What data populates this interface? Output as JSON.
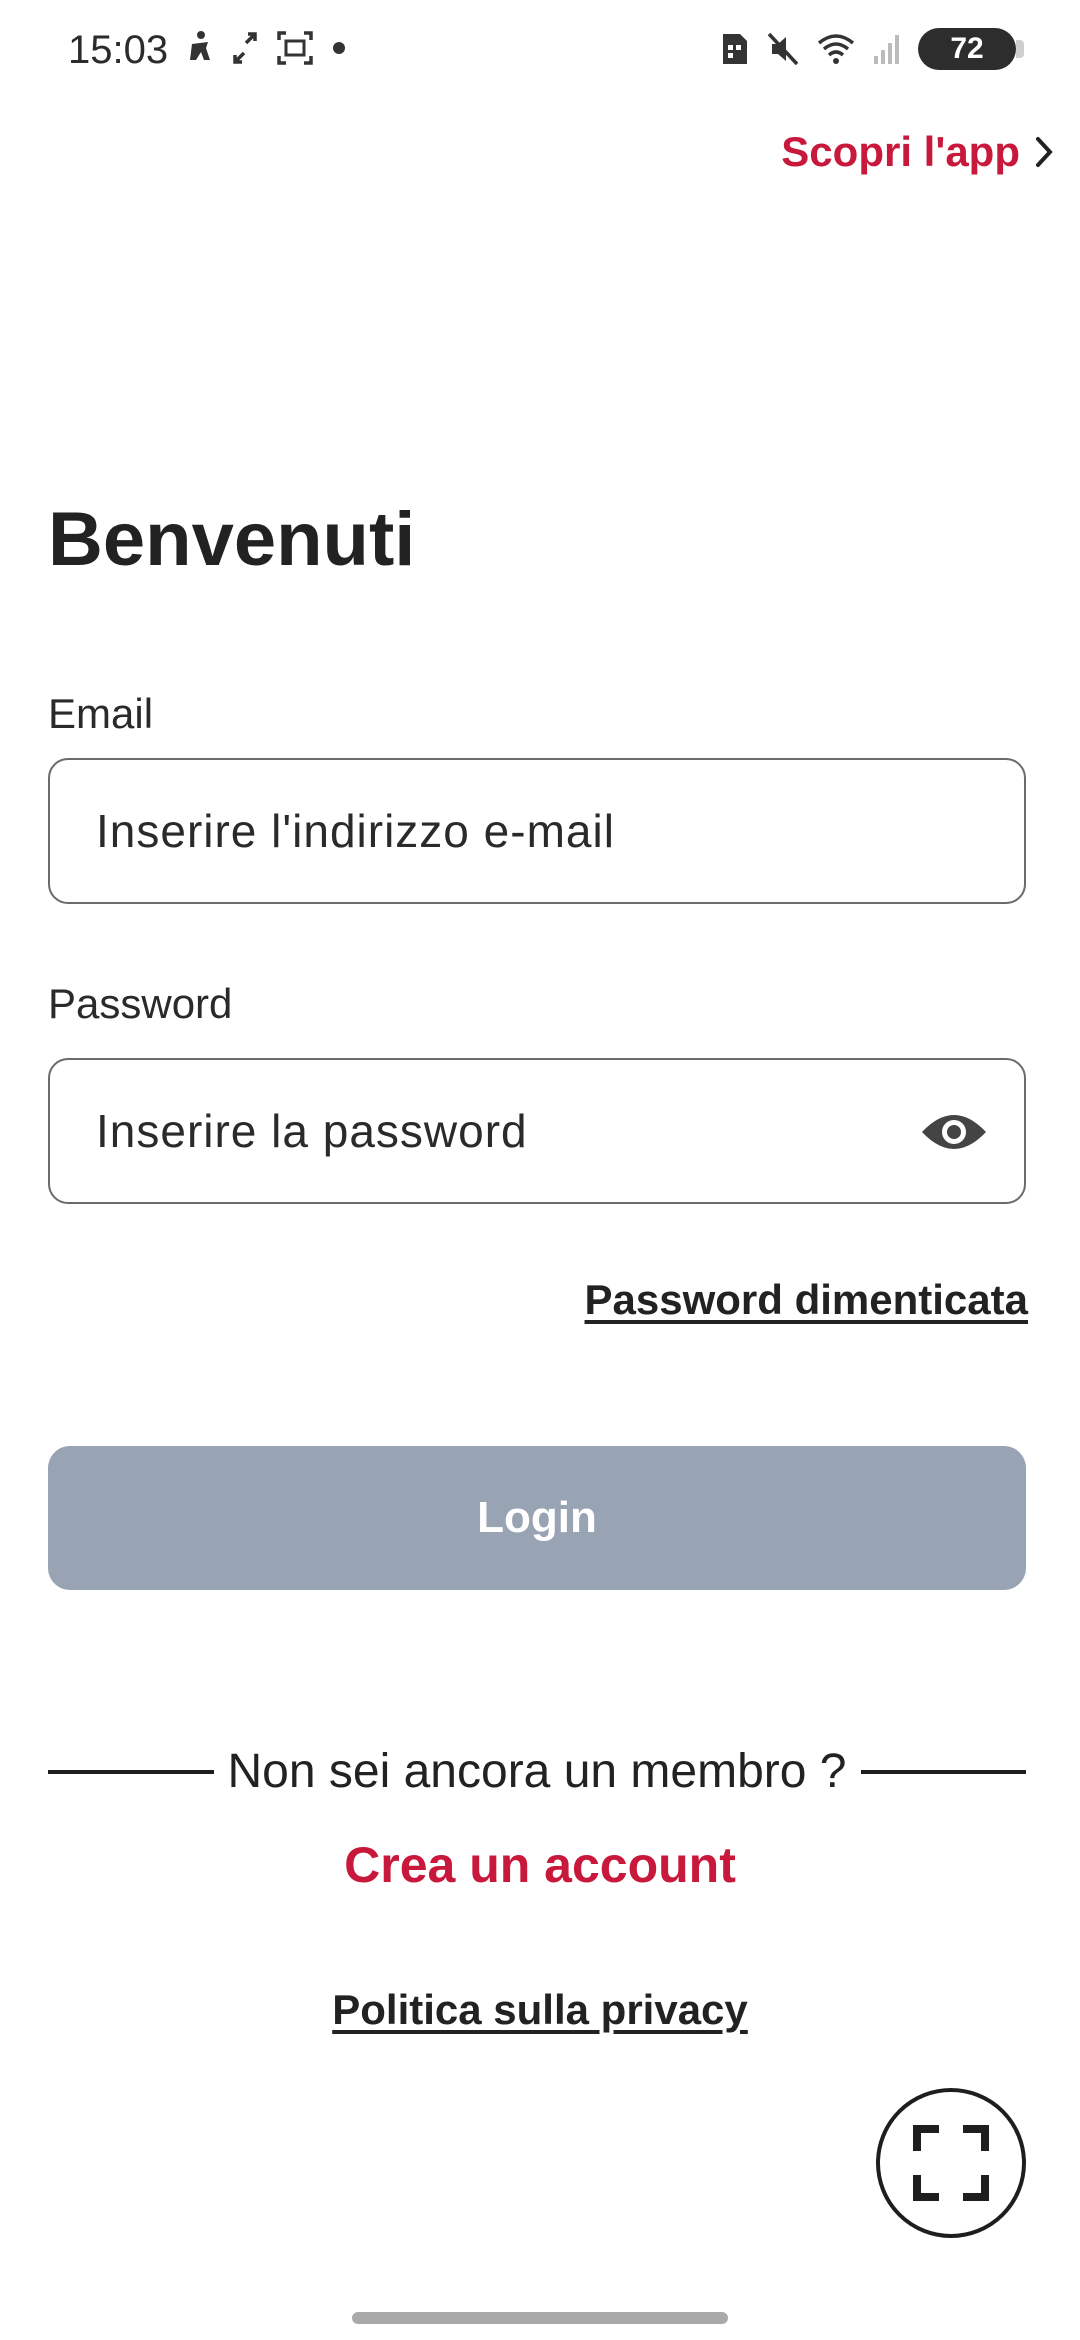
{
  "status_bar": {
    "time": "15:03",
    "battery_level": "72",
    "left_icons": [
      "accessibility-icon",
      "expand-arrows-icon",
      "screenshot-icon",
      "notification-dot-icon"
    ],
    "right_icons": [
      "sim-card-icon",
      "mute-icon",
      "wifi-icon",
      "signal-icon",
      "battery-icon"
    ]
  },
  "header": {
    "discover_label": "Scopri l'app"
  },
  "main": {
    "title": "Benvenuti",
    "email": {
      "label": "Email",
      "placeholder": "Inserire l'indirizzo e-mail",
      "value": ""
    },
    "password": {
      "label": "Password",
      "placeholder": "Inserire la password",
      "value": ""
    },
    "forgot_password_label": "Password dimenticata",
    "login_label": "Login",
    "not_member_text": "Non sei ancora un membro ?",
    "create_account_label": "Crea un account",
    "privacy_label": "Politica sulla privacy"
  },
  "colors": {
    "accent": "#c8193c",
    "login_disabled": "#98a3b3",
    "text": "#222222"
  }
}
